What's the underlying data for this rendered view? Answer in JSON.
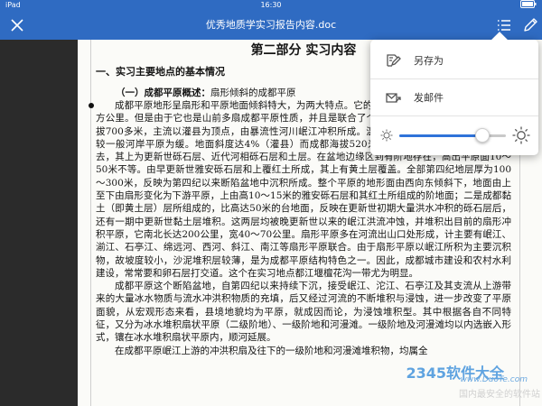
{
  "status": {
    "device": "iPad",
    "time": "16:30",
    "battery": ""
  },
  "toolbar": {
    "title": "优秀地质学实习报告内容.doc"
  },
  "doc": {
    "part_title": "第二部分    实习内容",
    "section_title": "一、实习主要地点的基本情况",
    "sub_title": "（一）成都平原概述：",
    "sub_title_rest": "扇形倾斜的成都平原",
    "paragraphs": [
      "成都平原地形呈扇形和平原地面倾斜特大，为两大特点。它的地形主要平原计算，只有6000平方公里。但是由于它也是山前多扇成都平原性质，并且是联合了个扇形平原组成，故面积特大，海拔700多米，主流以灌县为顶点，由暴流性河川岷江冲积所成。温江南部的都江堰以北，扇形地势较一般河岸平原为缓。地面斜度达4%（灌县）而成都海拔520米计）。平原的组成物质是自北东去，其上为更新世砾石层、近代河相砾石层和土层。在盆地边缘区到有阶地存在，高出平原面10～50米不等。由早更新世雅安砾石层和上覆红土所成，其上有黄土层覆盖。全部第四纪地层厚为100～300米，反映为第四纪以来断陷盆地中沉积所成。整个平原的地形面由西向东倾斜下，地面由上至下由扇形变化为下游平原，上由高10～15米的雅安砾石层和其红土所组成的阶地面；二是成都黏土（即黄土层）层所组成的，比高达50米的台地面，反映在更新世初期大量洪水冲积的砾石层后，还有一期中更新世黏土层堆积。这两层均被晚更新世以来的岷江洪流冲蚀，并堆积出目前的扇形冲积平原，它南北长达200公里，宽40～70公里。扇形平原多在河流出山口处形成，计主要有岷江、湔江、石亭江、绵远河、西河、斜江、南江等扇形平原联合。由于扇形平原以岷江所积为主要沉积物，故坡度较小，沙泥堆积层较薄，是为成都平原结构特色之一。因此，成都城市建设和农村水利建设，常常要和卵石层打交道。这个在实习地点都江堰檀花沟一带尤为明显。",
      "成都平原这个断陷盆地，自第四纪以来持续下沉，接受岷江、沱江、石亭江及其支流从上游带来的大量冰水物质与流水冲洪积物质的充填，后又经过河流的不断堆积与浸蚀，进一步改变了平原面貌，从宏观形态来看，县境地貌均为平原，就成因而论，为浸蚀堆积型。其中根据各自不同特征，又分为冰水堆积扇状平原（二级阶地）、一级阶地和河漫滩。一级阶地及河漫滩均以内选嵌入形式，镶在冰水堆积扇状平原内，顺河延展。",
      "在成都平原岷江上游的冲洪积扇及往下的一级阶地和河漫滩堆积物，均属全"
    ]
  },
  "menu": {
    "save_as": "另存为",
    "send_mail": "发邮件",
    "brightness": 0.78
  },
  "watermark": {
    "brand": "2345软件大全",
    "url": "www.DuoTe.com",
    "slogan": "国内最安全的软件站"
  }
}
